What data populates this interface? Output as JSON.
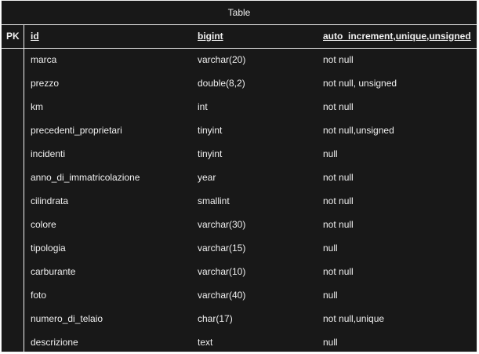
{
  "table": {
    "title": "Table",
    "pk_header": "PK",
    "header": {
      "name": "id",
      "type": "bigint",
      "constraints": "auto_increment,unique,unsigned"
    },
    "rows": [
      {
        "name": "marca",
        "type": "varchar(20)",
        "constraints": "not null"
      },
      {
        "name": "prezzo",
        "type": "double(8,2)",
        "constraints": "not null, unsigned"
      },
      {
        "name": "km",
        "type": "int",
        "constraints": "not null"
      },
      {
        "name": "precedenti_proprietari",
        "type": "tinyint",
        "constraints": "not null,unsigned"
      },
      {
        "name": "incidenti",
        "type": "tinyint",
        "constraints": "null"
      },
      {
        "name": "anno_di_immatricolazione",
        "type": "year",
        "constraints": "not null"
      },
      {
        "name": "cilindrata",
        "type": "smallint",
        "constraints": "not null"
      },
      {
        "name": "colore",
        "type": "varchar(30)",
        "constraints": "not null"
      },
      {
        "name": "tipologia",
        "type": "varchar(15)",
        "constraints": "null"
      },
      {
        "name": "carburante",
        "type": "varchar(10)",
        "constraints": "not null"
      },
      {
        "name": "foto",
        "type": "varchar(40)",
        "constraints": "null"
      },
      {
        "name": "numero_di_telaio",
        "type": "char(17)",
        "constraints": "not null,unique"
      },
      {
        "name": "descrizione",
        "type": "text",
        "constraints": "null"
      }
    ]
  }
}
